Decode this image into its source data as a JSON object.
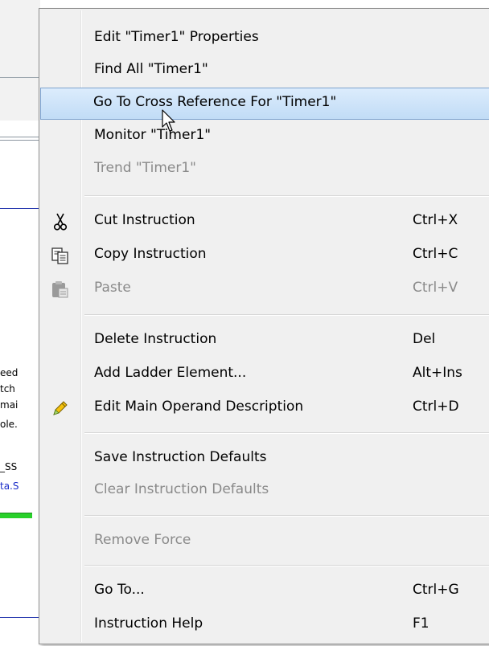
{
  "background": {
    "fragments": [
      "eed",
      "tch",
      " mai",
      "ole.",
      "_SS",
      "ta.S"
    ]
  },
  "menu": {
    "items": [
      {
        "label": "Edit \"Timer1\" Properties",
        "shortcut": "",
        "disabled": false
      },
      {
        "label": "Find All \"Timer1\"",
        "shortcut": "",
        "disabled": false
      },
      {
        "label": "Go To Cross Reference For \"Timer1\"",
        "shortcut": "",
        "disabled": false,
        "highlighted": true
      },
      {
        "label": "Monitor \"Timer1\"",
        "shortcut": "",
        "disabled": false
      },
      {
        "label": "Trend \"Timer1\"",
        "shortcut": "",
        "disabled": true
      },
      {
        "label": "Cut Instruction",
        "shortcut": "Ctrl+X",
        "disabled": false,
        "icon": "scissors-icon"
      },
      {
        "label": "Copy Instruction",
        "shortcut": "Ctrl+C",
        "disabled": false,
        "icon": "copy-icon"
      },
      {
        "label": "Paste",
        "shortcut": "Ctrl+V",
        "disabled": true,
        "icon": "paste-icon"
      },
      {
        "label": "Delete Instruction",
        "shortcut": "Del",
        "disabled": false
      },
      {
        "label": "Add Ladder Element...",
        "shortcut": "Alt+Ins",
        "disabled": false
      },
      {
        "label": "Edit Main Operand Description",
        "shortcut": "Ctrl+D",
        "disabled": false,
        "icon": "pencil-icon"
      },
      {
        "label": "Save Instruction Defaults",
        "shortcut": "",
        "disabled": false
      },
      {
        "label": "Clear Instruction Defaults",
        "shortcut": "",
        "disabled": true
      },
      {
        "label": "Remove Force",
        "shortcut": "",
        "disabled": true
      },
      {
        "label": "Go To...",
        "shortcut": "Ctrl+G",
        "disabled": false
      },
      {
        "label": "Instruction Help",
        "shortcut": "F1",
        "disabled": false
      }
    ]
  },
  "colors": {
    "highlight_border": "#7da2ce",
    "disabled_text": "#8a8a8a"
  }
}
